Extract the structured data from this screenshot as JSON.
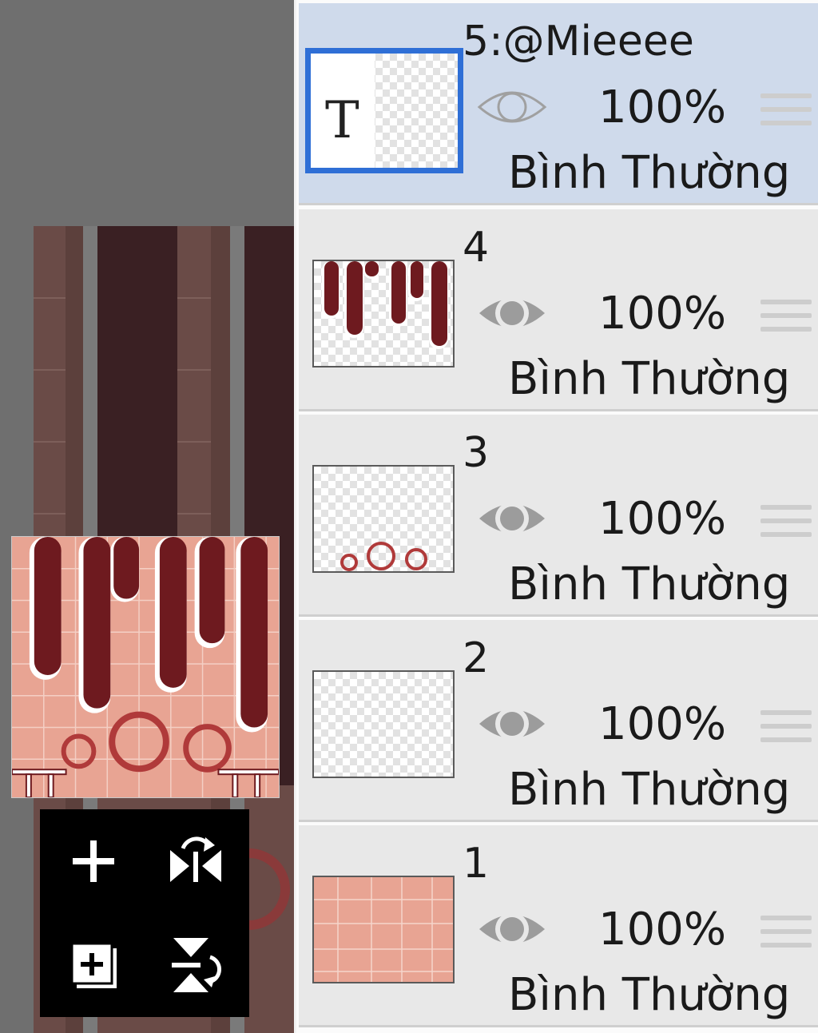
{
  "layers": [
    {
      "name": "5:@Mieeee",
      "opacity": "100%",
      "blend": "Bình Thường",
      "visible": false,
      "selected": true,
      "thumb": "text"
    },
    {
      "name": "4",
      "opacity": "100%",
      "blend": "Bình Thường",
      "visible": true,
      "selected": false,
      "thumb": "drips"
    },
    {
      "name": "3",
      "opacity": "100%",
      "blend": "Bình Thường",
      "visible": true,
      "selected": false,
      "thumb": "circles"
    },
    {
      "name": "2",
      "opacity": "100%",
      "blend": "Bình Thường",
      "visible": true,
      "selected": false,
      "thumb": "empty"
    },
    {
      "name": "1",
      "opacity": "100%",
      "blend": "Bình Thường",
      "visible": true,
      "selected": false,
      "thumb": "grid"
    }
  ],
  "text_layer_thumb_glyph": "T",
  "tools": {
    "add_layer_icon": "plus-icon",
    "flip_horizontal_icon": "flip-horizontal-icon",
    "add_layer_copy_icon": "add-copy-icon",
    "flip_vertical_icon": "flip-vertical-icon"
  },
  "colors": {
    "selected_row": "#cfdaeb",
    "selection_border": "#2f6fd6",
    "drip": "#6e1a1f",
    "peach": "#e8a493"
  }
}
